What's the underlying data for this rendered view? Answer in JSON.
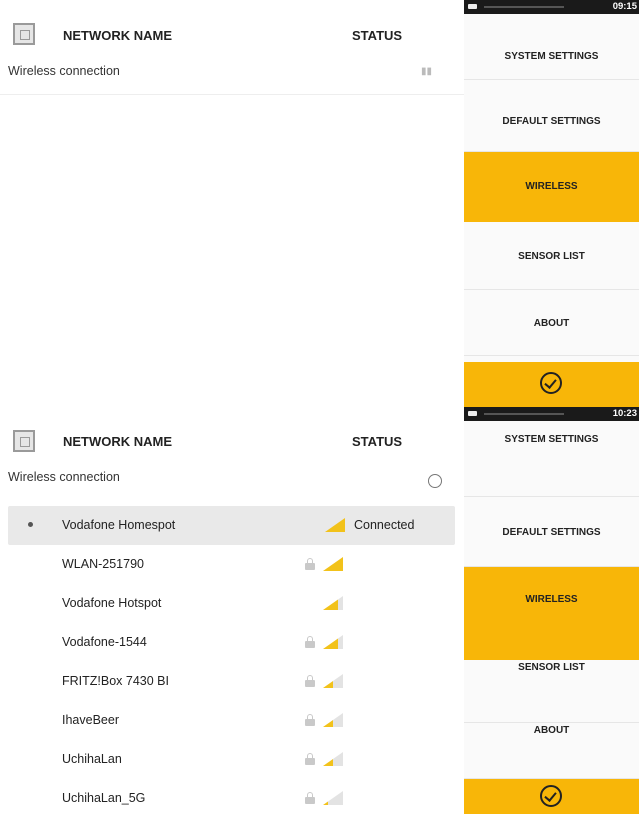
{
  "screens": [
    {
      "header": {
        "col_name": "NETWORK NAME",
        "col_status": "STATUS"
      },
      "wireless_label": "Wireless connection",
      "statusbar_time": "09:15",
      "menu": [
        "SYSTEM SETTINGS",
        "DEFAULT SETTINGS",
        "WIRELESS",
        "SENSOR LIST",
        "ABOUT"
      ],
      "active_menu": "WIRELESS",
      "networks": []
    },
    {
      "header": {
        "col_name": "NETWORK NAME",
        "col_status": "STATUS"
      },
      "wireless_label": "Wireless connection",
      "statusbar_time": "10:23",
      "menu": [
        "SYSTEM SETTINGS",
        "DEFAULT SETTINGS",
        "WIRELESS",
        "SENSOR LIST",
        "ABOUT"
      ],
      "active_menu": "WIRELESS",
      "networks": [
        {
          "ssid": "Vodafone Homespot",
          "secured": false,
          "signal": 4,
          "status": "Connected",
          "selected": true
        },
        {
          "ssid": "WLAN-251790",
          "secured": true,
          "signal": 4,
          "status": "",
          "selected": false
        },
        {
          "ssid": "Vodafone Hotspot",
          "secured": false,
          "signal": 3,
          "status": "",
          "selected": false
        },
        {
          "ssid": "Vodafone-1544",
          "secured": true,
          "signal": 3,
          "status": "",
          "selected": false
        },
        {
          "ssid": "FRITZ!Box 7430 BI",
          "secured": true,
          "signal": 2,
          "status": "",
          "selected": false
        },
        {
          "ssid": "IhaveBeer",
          "secured": true,
          "signal": 2,
          "status": "",
          "selected": false
        },
        {
          "ssid": "UchihaLan",
          "secured": true,
          "signal": 2,
          "status": "",
          "selected": false
        },
        {
          "ssid": "UchihaLan_5G",
          "secured": true,
          "signal": 1,
          "status": "",
          "selected": false
        }
      ]
    }
  ],
  "colors": {
    "accent": "#f8b608",
    "signal_on": "#f2c21a",
    "signal_off": "#e3e3e3"
  }
}
